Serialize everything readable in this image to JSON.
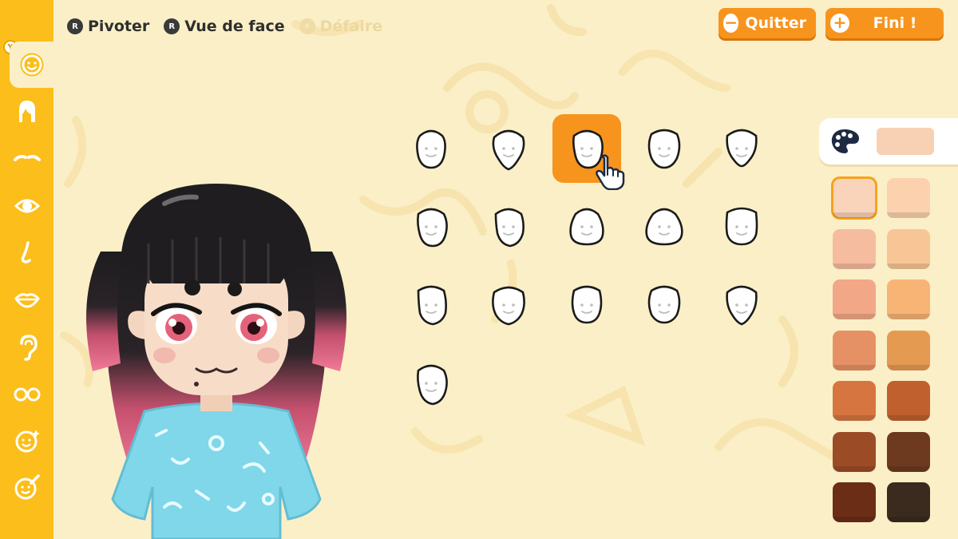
{
  "topbar": {
    "rotate_label": "Pivoter",
    "front_view_label": "Vue de face",
    "undo_label": "Défaire",
    "quit_label": "Quitter",
    "done_label": "Fini !"
  },
  "sidebar": {
    "badge": "Y",
    "items": [
      {
        "icon": "face-shape-icon",
        "active": true
      },
      {
        "icon": "hair-icon"
      },
      {
        "icon": "eyebrows-icon"
      },
      {
        "icon": "eye-icon"
      },
      {
        "icon": "nose-icon"
      },
      {
        "icon": "mouth-icon"
      },
      {
        "icon": "ear-icon"
      },
      {
        "icon": "glasses-icon"
      },
      {
        "icon": "makeup-icon"
      },
      {
        "icon": "face-paint-icon"
      }
    ]
  },
  "face_shapes": {
    "count": 16,
    "selected_index": 2
  },
  "skin_colors": {
    "palette_icon": "palette-icon",
    "current": "#f8d0b4",
    "selected_index": 0,
    "swatches": [
      "#f9d4bb",
      "#fbd1ae",
      "#f6bca0",
      "#f8c696",
      "#f2a887",
      "#f7b475",
      "#e69165",
      "#e59a52",
      "#d77540",
      "#c0602e",
      "#9c4b27",
      "#6d3a1f",
      "#6c2d16",
      "#3a2b1e"
    ]
  }
}
